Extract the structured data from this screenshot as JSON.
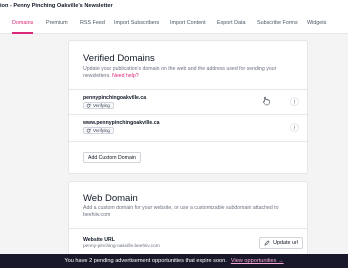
{
  "header": {
    "title": "ion - Penny Pinching Oakville's Newsletter"
  },
  "tabs": [
    {
      "label": "Domains",
      "active": true
    },
    {
      "label": "Premium"
    },
    {
      "label": "RSS Feed"
    },
    {
      "label": "Import Subscribers"
    },
    {
      "label": "Import Content"
    },
    {
      "label": "Export Data"
    },
    {
      "label": "Subscribe Forms"
    },
    {
      "label": "Widgets"
    }
  ],
  "verified_domains": {
    "title": "Verified Domains",
    "description": "Update your publication's domain on the web and the address used for sending your newsletters.",
    "help_link": "Need help?",
    "domains": [
      {
        "name": "pennypinchingoakville.ca",
        "status": "Verifying"
      },
      {
        "name": "www.pennypinchingoakville.ca",
        "status": "Verifying"
      }
    ],
    "add_button": "Add Custom Domain"
  },
  "web_domain": {
    "title": "Web Domain",
    "description": "Add a custom domain for your website, or use a customizable subdomain attached to beehiiv.com",
    "field_label": "Website URL",
    "field_value": "penny-pinching-oakville.beehiiv.com",
    "update_button": "Update url"
  },
  "banner": {
    "text": "You have 2 pending advertisement opportunities that expire soon.",
    "link": "View opportunities →"
  },
  "colors": {
    "accent": "#db2777",
    "banner_bg": "#18182a",
    "background": "#f4f4f5"
  }
}
